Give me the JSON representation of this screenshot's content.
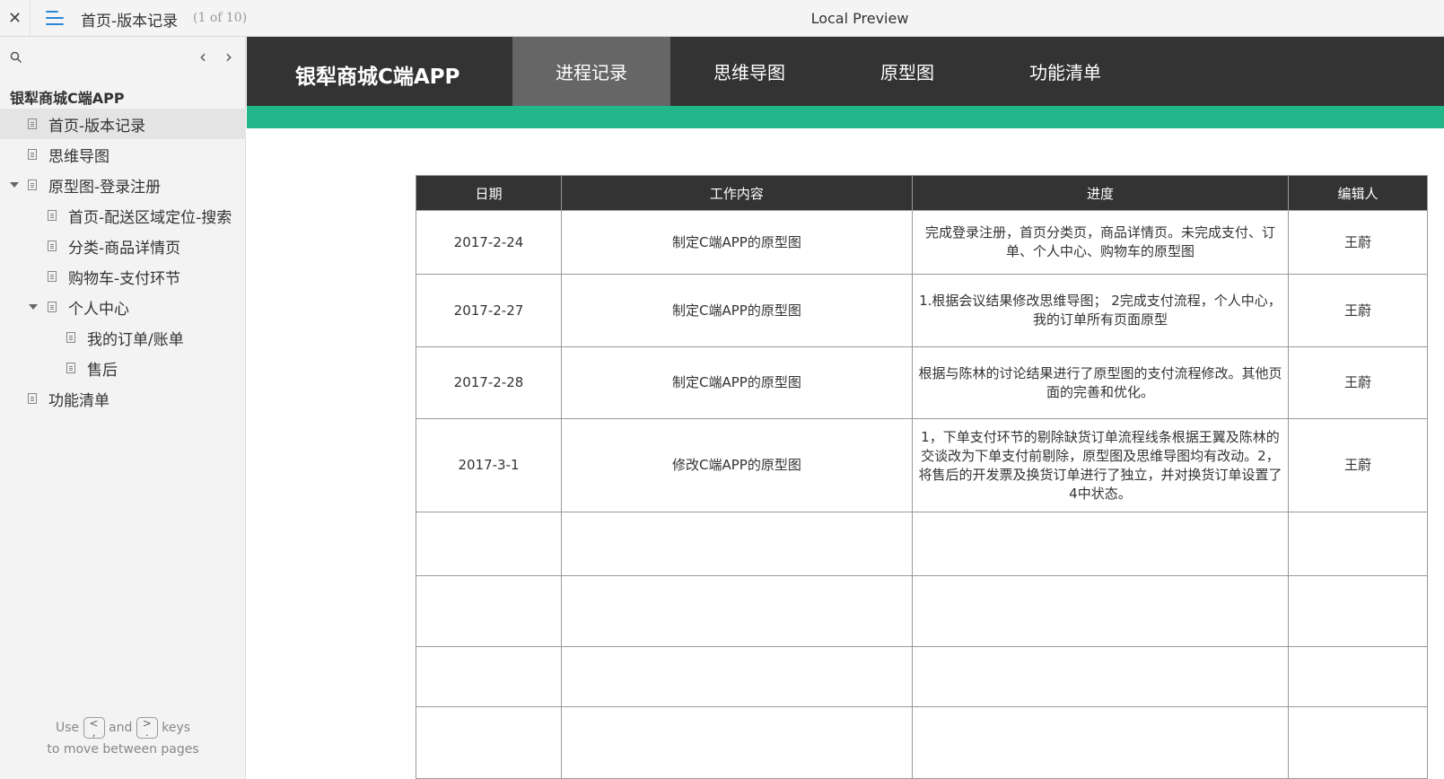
{
  "window": {
    "close_glyph": "✕",
    "page_title": "首页-版本记录",
    "page_count": "(1 of 10)",
    "preview_title": "Local Preview"
  },
  "sidebar": {
    "nav_prev": "‹",
    "nav_next": "›",
    "project_title": "银犁商城C端APP",
    "items": [
      {
        "label": "首页-版本记录"
      },
      {
        "label": "思维导图"
      },
      {
        "label": "原型图-登录注册"
      },
      {
        "label": "首页-配送区域定位-搜索"
      },
      {
        "label": "分类-商品详情页"
      },
      {
        "label": "购物车-支付环节"
      },
      {
        "label": "个人中心"
      },
      {
        "label": "我的订单/账单"
      },
      {
        "label": "售后"
      },
      {
        "label": "功能清单"
      }
    ],
    "hint": {
      "use": "Use",
      "key1": "<",
      "key1_sub": ",",
      "and": "and",
      "key2": ">",
      "key2_sub": ".",
      "keys": "keys",
      "line2": "to move between pages"
    }
  },
  "app": {
    "brand": "银犁商城C端APP",
    "tabs": [
      {
        "label": "进程记录"
      },
      {
        "label": "思维导图"
      },
      {
        "label": "原型图"
      },
      {
        "label": "功能清单"
      }
    ],
    "accent_color": "#22b68a",
    "header_color": "#333333"
  },
  "table": {
    "headers": [
      "日期",
      "工作内容",
      "进度",
      "编辑人"
    ],
    "rows": [
      {
        "date": "2017-2-24",
        "work": "制定C端APP的原型图",
        "progress": "完成登录注册，首页分类页，商品详情页。未完成支付、订单、个人中心、购物车的原型图",
        "editor": "王蔚"
      },
      {
        "date": "2017-2-27",
        "work": "制定C端APP的原型图",
        "progress": "1.根据会议结果修改思维导图； 2完成支付流程，个人中心，我的订单所有页面原型",
        "editor": "王蔚"
      },
      {
        "date": "2017-2-28",
        "work": "制定C端APP的原型图",
        "progress": "根据与陈林的讨论结果进行了原型图的支付流程修改。其他页面的完善和优化。",
        "editor": "王蔚"
      },
      {
        "date": "2017-3-1",
        "work": "修改C端APP的原型图",
        "progress": "1，下单支付环节的剔除缺货订单流程线条根据王翼及陈林的交谈改为下单支付前剔除，原型图及思维导图均有改动。2，将售后的开发票及换货订单进行了独立，并对换货订单设置了4中状态。",
        "editor": "王蔚"
      }
    ]
  }
}
